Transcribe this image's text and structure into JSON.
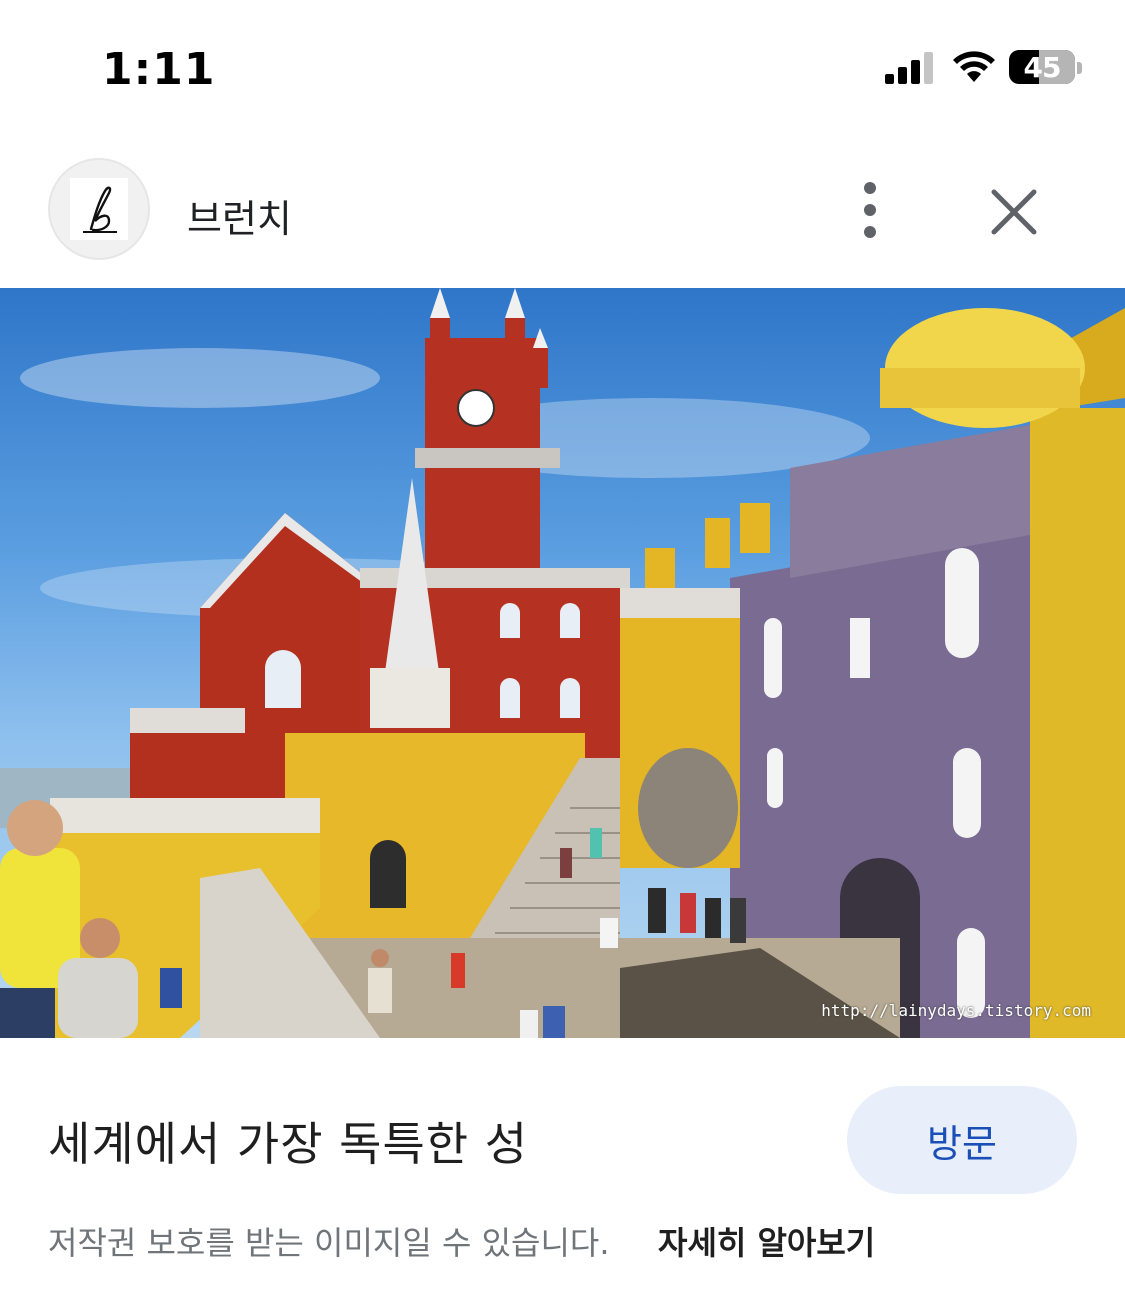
{
  "status_bar": {
    "time": "1:11",
    "battery_level": "45",
    "icons": [
      "signal-icon",
      "wifi-icon",
      "battery-icon"
    ]
  },
  "header": {
    "source_name": "브런치",
    "avatar_icon": "brunch-logo-icon",
    "more_icon": "more-vertical-icon",
    "close_icon": "close-icon"
  },
  "image": {
    "watermark": "http://lainydays.tistory.com"
  },
  "caption": {
    "title": "세계에서 가장 독특한 성",
    "visit_label": "방문",
    "copyright_text": "저작권 보호를 받는 이미지일 수 있습니다.",
    "learn_more_label": "자세히 알아보기"
  },
  "colors": {
    "accent": "#1a4fb8",
    "button_bg": "#e8eefa",
    "muted_text": "#70757a"
  }
}
